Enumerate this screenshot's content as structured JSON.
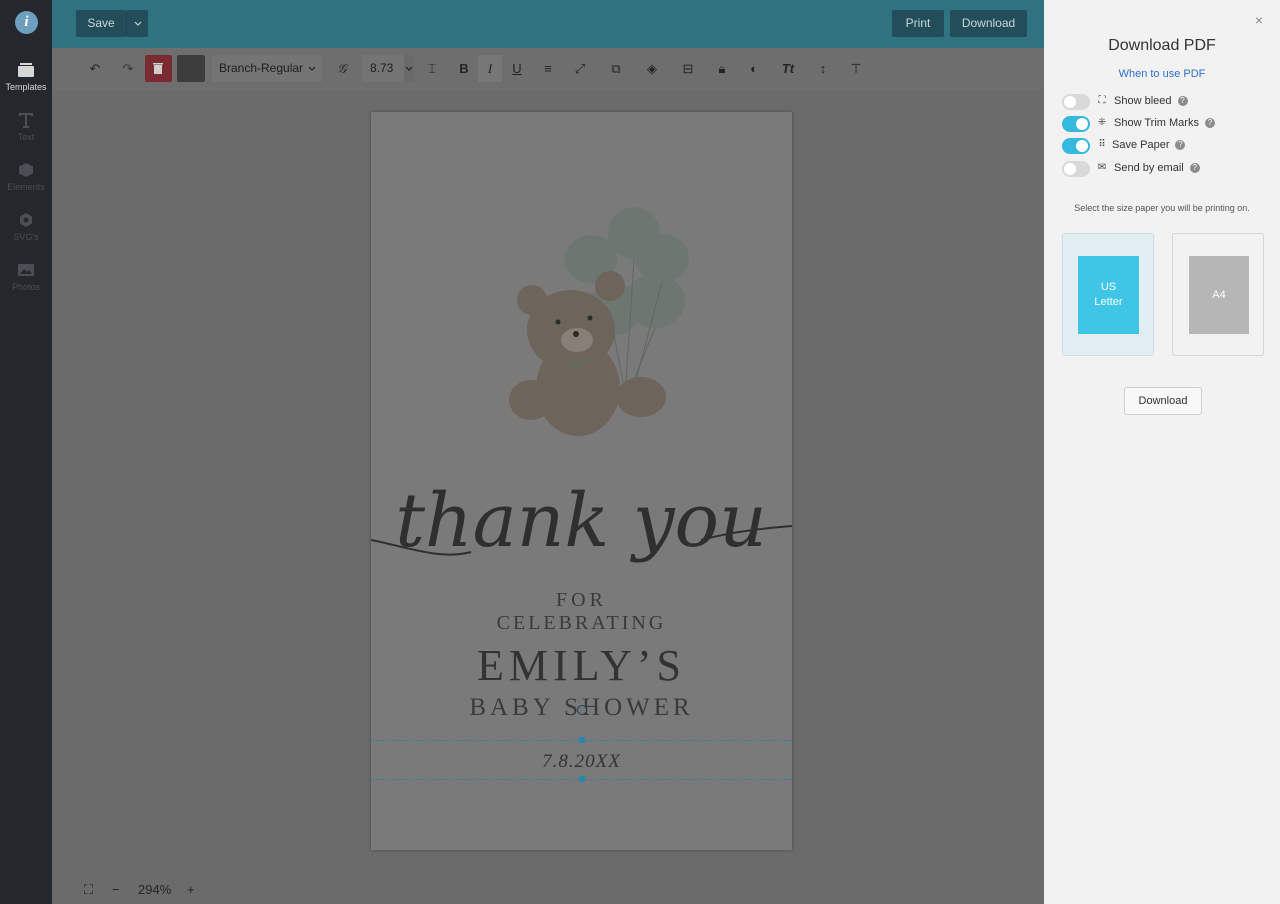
{
  "sidebar": {
    "logo": "i",
    "items": [
      {
        "label": "Templates",
        "icon": "templates-icon"
      },
      {
        "label": "Text",
        "icon": "text-icon"
      },
      {
        "label": "Elements",
        "icon": "elements-icon"
      },
      {
        "label": "SVG's",
        "icon": "svg-icon"
      },
      {
        "label": "Photos",
        "icon": "photos-icon"
      }
    ]
  },
  "topbar": {
    "save_label": "Save",
    "print_label": "Print",
    "download_label": "Download"
  },
  "toolbar": {
    "font_name": "Branch-Regular",
    "font_size": "8.73"
  },
  "card": {
    "script_text": "thank you",
    "line1": "FOR",
    "line2": "CELEBRATING",
    "name": "EMILY’S",
    "line4": "BABY SHOWER",
    "date": "7.8.20XX"
  },
  "status": {
    "zoom": "294%",
    "minus": "−",
    "plus": "+"
  },
  "panel": {
    "close": "×",
    "title": "Download PDF",
    "help_link": "When to use PDF",
    "options": [
      {
        "label": "Show bleed",
        "on": false,
        "icon": "expand-icon"
      },
      {
        "label": "Show Trim Marks",
        "on": true,
        "icon": "trim-marks-icon"
      },
      {
        "label": "Save Paper",
        "on": true,
        "icon": "grid-icon"
      },
      {
        "label": "Send by email",
        "on": false,
        "icon": "envelope-icon"
      }
    ],
    "select_label": "Select the size paper you will be printing on.",
    "papers": [
      {
        "label": "US\nLetter",
        "color": "#3fc5e6",
        "selected": true
      },
      {
        "label": "A4",
        "color": "#b6b6b6",
        "selected": false
      }
    ],
    "download_label": "Download"
  },
  "colors": {
    "accent": "#35b9de",
    "topbar": "#2f7381",
    "link": "#2f6fd0"
  }
}
